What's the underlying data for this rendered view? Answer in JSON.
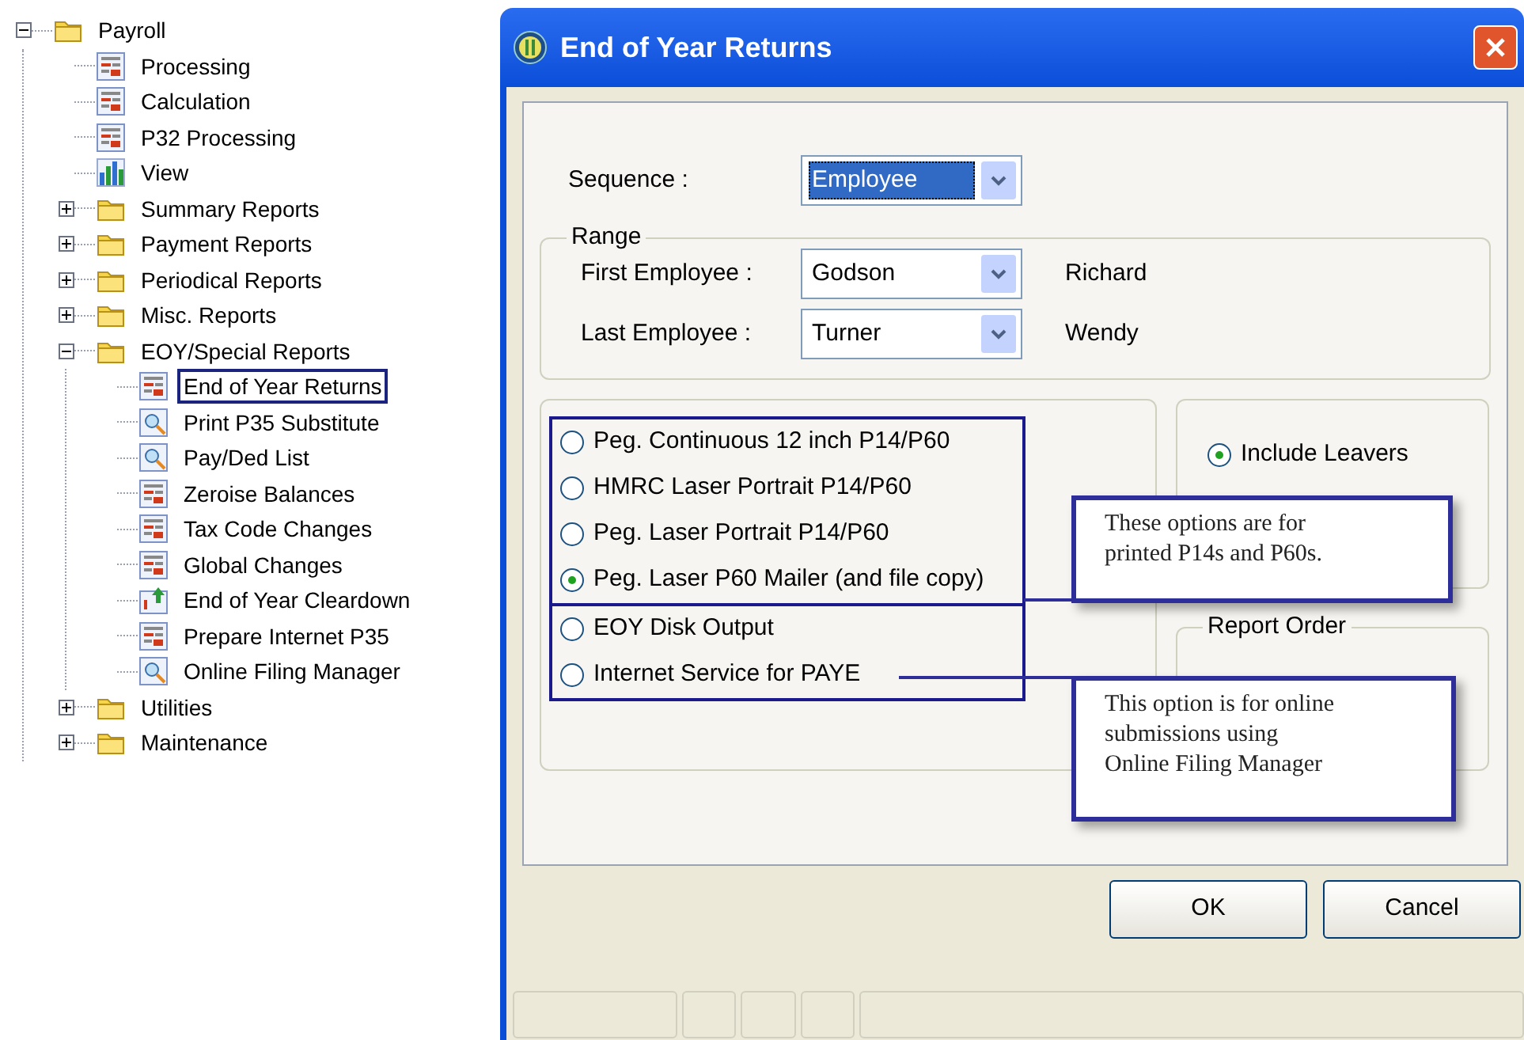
{
  "tree": {
    "label": "Payroll",
    "kind": "folder",
    "expanded": true,
    "selected": false,
    "children": [
      {
        "label": "Processing",
        "kind": "form",
        "selected": false
      },
      {
        "label": "Calculation",
        "kind": "form",
        "selected": false
      },
      {
        "label": "P32 Processing",
        "kind": "form",
        "selected": false
      },
      {
        "label": "View",
        "kind": "chart",
        "selected": false
      },
      {
        "label": "Summary Reports",
        "kind": "folder",
        "expanded": false,
        "selected": false
      },
      {
        "label": "Payment Reports",
        "kind": "folder",
        "expanded": false,
        "selected": false
      },
      {
        "label": "Periodical Reports",
        "kind": "folder",
        "expanded": false,
        "selected": false
      },
      {
        "label": "Misc. Reports",
        "kind": "folder",
        "expanded": false,
        "selected": false
      },
      {
        "label": "EOY/Special Reports",
        "kind": "folder",
        "expanded": true,
        "selected": false,
        "children": [
          {
            "label": "End of Year Returns",
            "kind": "form",
            "selected": true
          },
          {
            "label": "Print P35 Substitute",
            "kind": "preview",
            "selected": false
          },
          {
            "label": "Pay/Ded List",
            "kind": "preview",
            "selected": false
          },
          {
            "label": "Zeroise Balances",
            "kind": "form",
            "selected": false
          },
          {
            "label": "Tax Code Changes",
            "kind": "form",
            "selected": false
          },
          {
            "label": "Global Changes",
            "kind": "form",
            "selected": false
          },
          {
            "label": "End of Year Cleardown",
            "kind": "calendar",
            "selected": false
          },
          {
            "label": "Prepare Internet P35",
            "kind": "form",
            "selected": false
          },
          {
            "label": "Online Filing Manager",
            "kind": "preview",
            "selected": false
          }
        ]
      },
      {
        "label": "Utilities",
        "kind": "folder",
        "expanded": false,
        "selected": false
      },
      {
        "label": "Maintenance",
        "kind": "folder",
        "expanded": false,
        "selected": false
      }
    ]
  },
  "dialog": {
    "title": "End of Year Returns",
    "sequence": {
      "label": "Sequence :",
      "value": "Employee"
    },
    "range": {
      "title": "Range",
      "rows": [
        {
          "label": "First Employee :",
          "value": "Godson",
          "name": "Richard"
        },
        {
          "label": "Last Employee :",
          "value": "Turner",
          "name": "Wendy"
        }
      ]
    },
    "output_options": [
      {
        "label": "Peg. Continuous 12 inch P14/P60",
        "selected": false
      },
      {
        "label": "HMRC Laser Portrait P14/P60",
        "selected": false
      },
      {
        "label": "Peg. Laser Portrait P14/P60",
        "selected": false
      },
      {
        "label": "Peg. Laser P60 Mailer (and file copy)",
        "selected": true
      },
      {
        "label": "EOY Disk Output",
        "selected": false
      },
      {
        "label": "Internet Service for PAYE",
        "selected": false
      }
    ],
    "leavers": [
      {
        "label": "Include Leavers",
        "selected": true
      }
    ],
    "report_order": {
      "title": "Report Order"
    },
    "callouts": [
      [
        "These options are for",
        "printed P14s and P60s."
      ],
      [
        "This option is for online",
        "submissions using",
        "Online Filing Manager"
      ]
    ],
    "buttons": [
      "OK",
      "Cancel"
    ]
  }
}
